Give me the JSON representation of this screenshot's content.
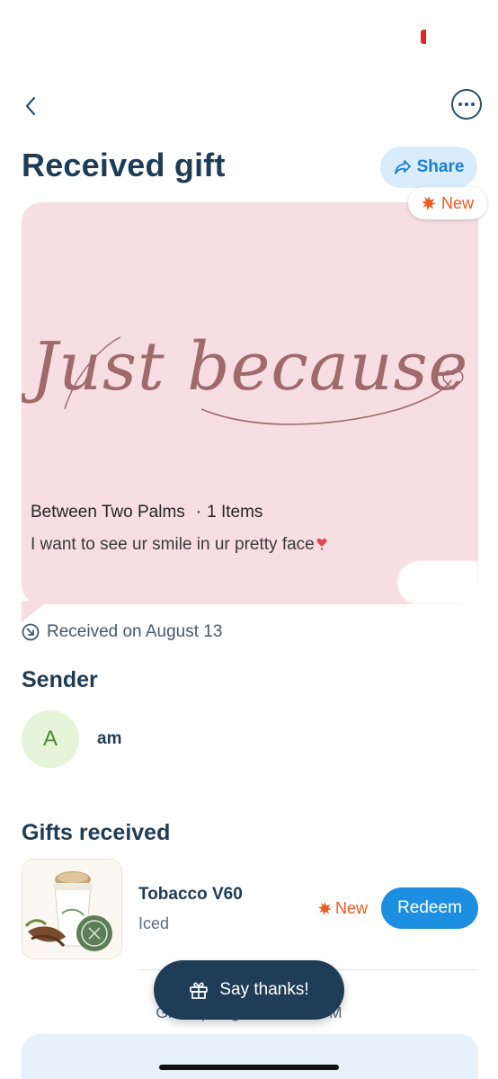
{
  "header": {
    "title": "Received gift",
    "share_label": "Share",
    "new_label": "New"
  },
  "gift_card": {
    "art_text": "Just because",
    "merchant": "Between Two Palms",
    "items_count": "1 Items",
    "message": "I want to see ur smile in ur pretty face"
  },
  "received": {
    "label": "Received on August 13"
  },
  "sender": {
    "section_title": "Sender",
    "avatar_initial": "A",
    "name": "am"
  },
  "gifts": {
    "section_title": "Gifts received",
    "items": [
      {
        "name": "Tobacco V60",
        "variant": "Iced",
        "badge": "New",
        "action_label": "Redeem"
      }
    ]
  },
  "footer": {
    "expiry_text": "Gift expiring o                           at 01:38 PM",
    "say_thanks_label": "Say thanks!"
  },
  "colors": {
    "accent": "#1d8fe0",
    "new_badge": "#ea5a1e",
    "card_bg": "#f6dee2",
    "title": "#1e3c56"
  }
}
